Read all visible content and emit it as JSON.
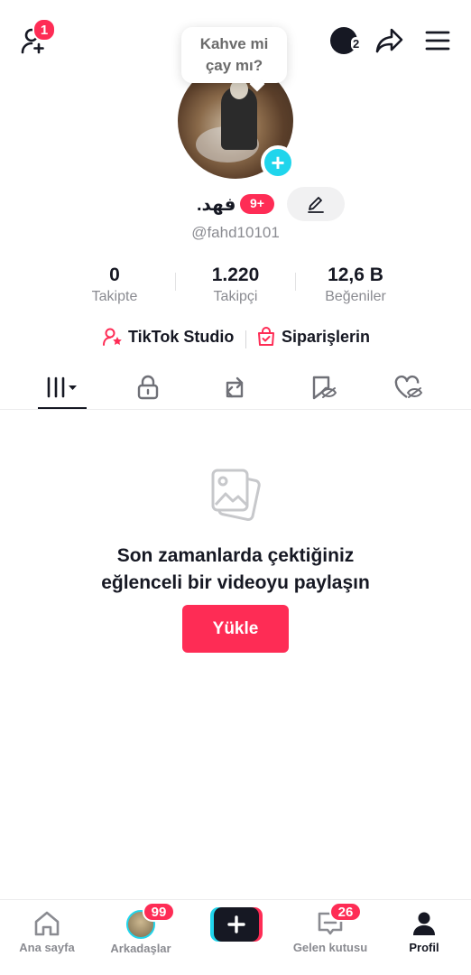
{
  "topbar": {
    "add_friend_badge": "1",
    "story_count": "2",
    "tooltip_line1": "Kahve mi",
    "tooltip_line2": "çay mı?"
  },
  "profile": {
    "display_name": "فهد.",
    "name_badge": "9+",
    "username": "@fahd10101"
  },
  "stats": [
    {
      "value": "0",
      "label": "Takipte"
    },
    {
      "value": "1.220",
      "label": "Takipçi"
    },
    {
      "value": "12,6 B",
      "label": "Beğeniler"
    }
  ],
  "links": {
    "studio": "TikTok Studio",
    "orders": "Siparişlerin"
  },
  "tabs": [
    "videos-icon",
    "lock-icon",
    "repost-icon",
    "hidden-icon",
    "liked-icon"
  ],
  "empty_state": {
    "line1": "Son zamanlarda çektiğiniz",
    "line2": "eğlenceli bir videoyu paylaşın",
    "upload_label": "Yükle"
  },
  "bottom_nav": {
    "home": "Ana sayfa",
    "friends": "Arkadaşlar",
    "friends_badge": "99",
    "inbox": "Gelen kutusu",
    "inbox_badge": "26",
    "profile": "Profil"
  },
  "colors": {
    "accent": "#fe2c55",
    "cyan": "#20d5ec",
    "text": "#161823",
    "muted": "#8a8b91"
  }
}
